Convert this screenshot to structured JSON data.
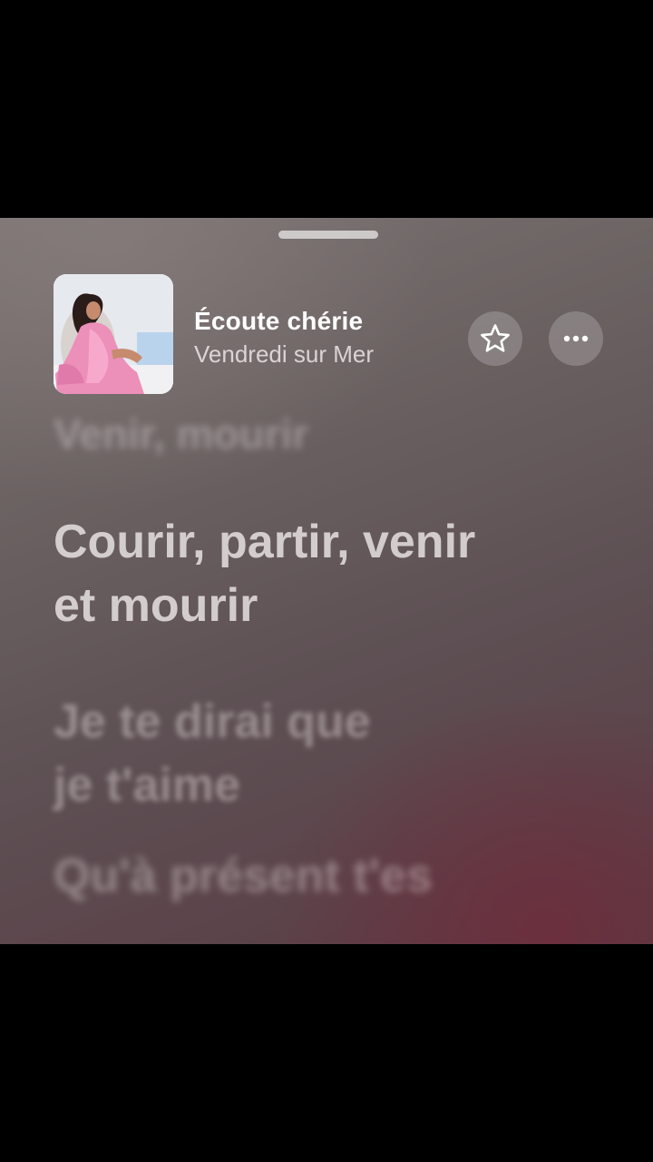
{
  "song": {
    "title": "Écoute chérie",
    "artist": "Vendredi sur Mer"
  },
  "actions": {
    "favorite_icon": "star-icon",
    "more_icon": "ellipsis-icon"
  },
  "lyrics": {
    "previous": [
      "Venir, mourir"
    ],
    "current": [
      "Courir, partir, venir",
      "et mourir"
    ],
    "next": [
      "Je te dirai que",
      "je t'aime"
    ],
    "next2": [
      "Qu'à présent t'es"
    ]
  },
  "colors": {
    "outer_background": "#000000",
    "gradient_top": "#7b7473",
    "gradient_bottom": "#5a3a43",
    "accent_wine": "#6e2d3c"
  }
}
